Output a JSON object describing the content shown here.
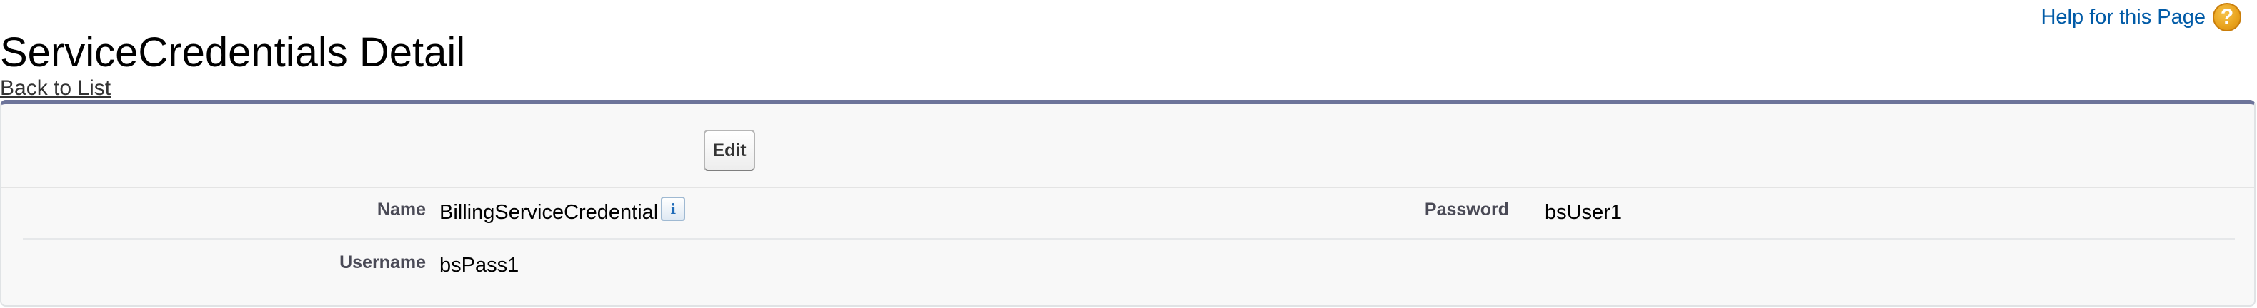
{
  "header": {
    "title": "ServiceCredentials Detail",
    "help_label": "Help for this Page",
    "help_icon": "question-mark-icon",
    "help_glyph": "?"
  },
  "navigation": {
    "back_label": "Back to List"
  },
  "detail": {
    "edit_label": "Edit",
    "info_icon": "info-icon",
    "info_glyph": "i",
    "fields": {
      "name_label": "Name",
      "name_value": "BillingServiceCredential",
      "password_label": "Password",
      "password_value": "bsUser1",
      "username_label": "Username",
      "username_value": "bsPass1"
    }
  },
  "colors": {
    "panel_top_border": "#6d749a",
    "panel_background": "#f8f8f8",
    "link": "#015ba7",
    "help_icon": "#e8a21c"
  }
}
